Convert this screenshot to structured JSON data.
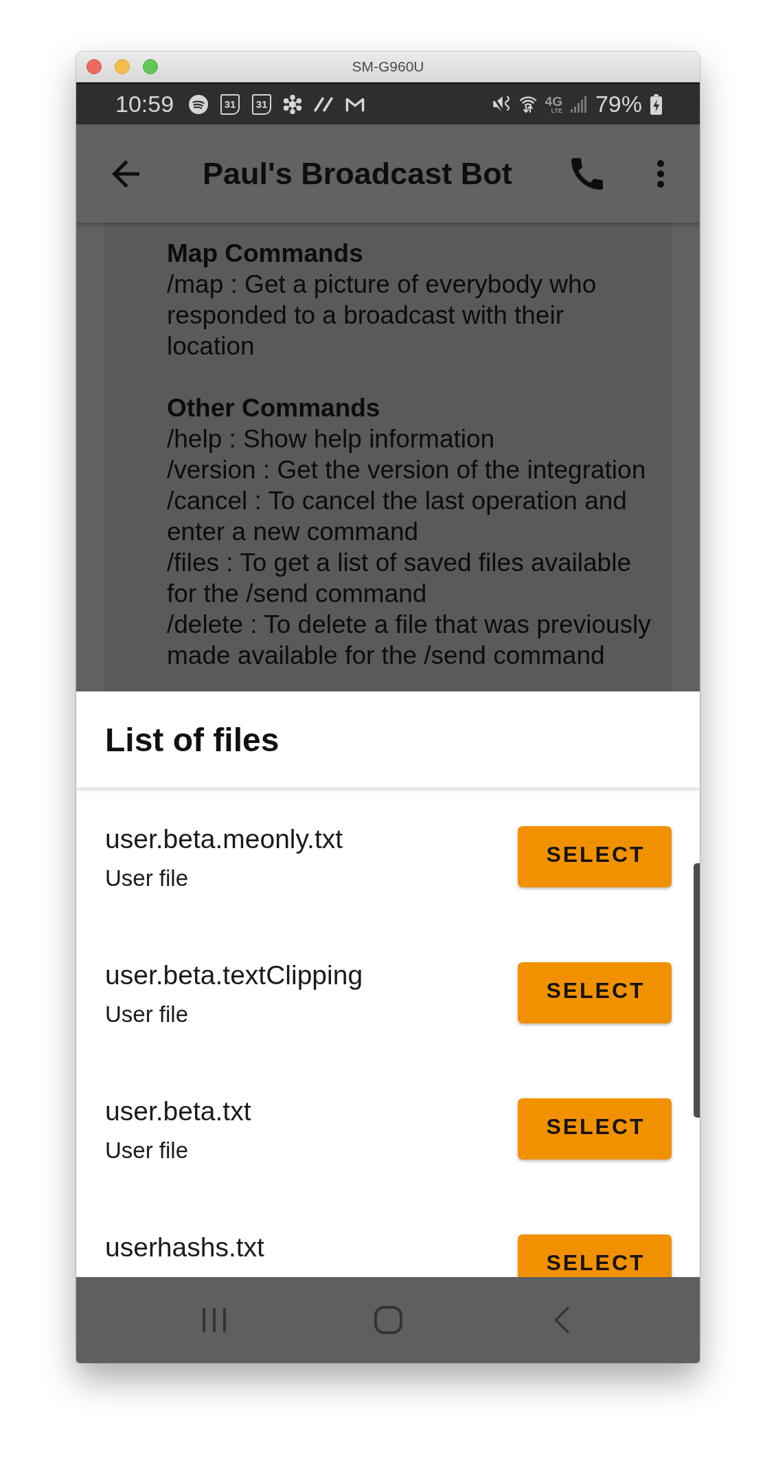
{
  "window": {
    "title": "SM-G960U"
  },
  "status_bar": {
    "time": "10:59",
    "calendar_labels": [
      "31",
      "31"
    ],
    "network": {
      "label": "4G",
      "sublabel": "LTE"
    },
    "battery": "79%"
  },
  "app_bar": {
    "title": "Paul's Broadcast Bot"
  },
  "message": {
    "sections": [
      {
        "heading": "Map Commands",
        "lines": [
          "/map : Get a picture of everybody who responded to a broadcast with their location"
        ]
      },
      {
        "heading": "Other Commands",
        "lines": [
          "/help : Show help information",
          "/version : Get the version of the integration",
          "/cancel : To cancel the last operation and enter a new command",
          "/files : To get a list of saved files available for the /send command",
          "/delete : To delete a file that was previously made available for the /send command"
        ]
      }
    ]
  },
  "sheet": {
    "title": "List of files",
    "files": [
      {
        "name": "user.beta.meonly.txt",
        "type": "User file",
        "button": "SELECT"
      },
      {
        "name": "user.beta.textClipping",
        "type": "User file",
        "button": "SELECT"
      },
      {
        "name": "user.beta.txt",
        "type": "User file",
        "button": "SELECT"
      },
      {
        "name": "userhashs.txt",
        "button": "SELECT"
      }
    ]
  }
}
